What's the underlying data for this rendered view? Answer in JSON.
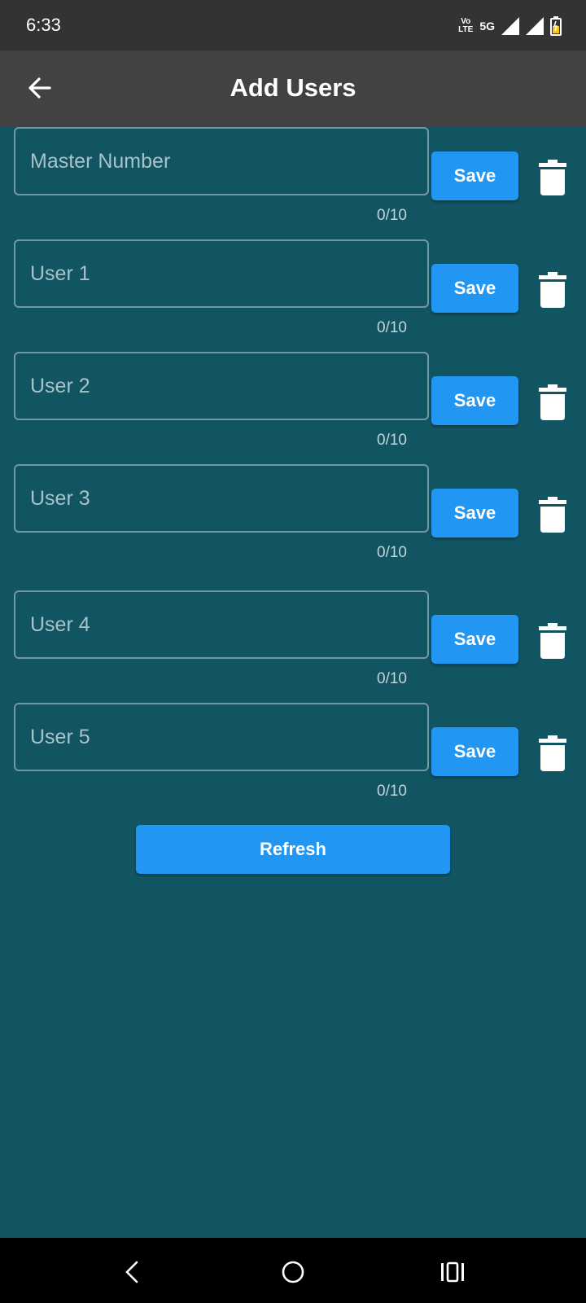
{
  "status_bar": {
    "time": "6:33",
    "volte_top": "Vo",
    "volte_bottom": "LTE",
    "network": "5G"
  },
  "app_bar": {
    "title": "Add Users",
    "back_icon": "arrow-left-icon"
  },
  "users": [
    {
      "placeholder": "Master Number",
      "value": "",
      "counter": "0/10",
      "save_label": "Save"
    },
    {
      "placeholder": "User 1",
      "value": "",
      "counter": "0/10",
      "save_label": "Save"
    },
    {
      "placeholder": "User 2",
      "value": "",
      "counter": "0/10",
      "save_label": "Save"
    },
    {
      "placeholder": "User 3",
      "value": "",
      "counter": "0/10",
      "save_label": "Save"
    },
    {
      "placeholder": "User 4",
      "value": "",
      "counter": "0/10",
      "save_label": "Save"
    },
    {
      "placeholder": "User 5",
      "value": "",
      "counter": "0/10",
      "save_label": "Save"
    }
  ],
  "refresh_label": "Refresh",
  "colors": {
    "background": "#115462",
    "app_bar": "#424242",
    "status_bar": "#333333",
    "button": "#2196f3",
    "field_border": "#6f9aa3"
  }
}
